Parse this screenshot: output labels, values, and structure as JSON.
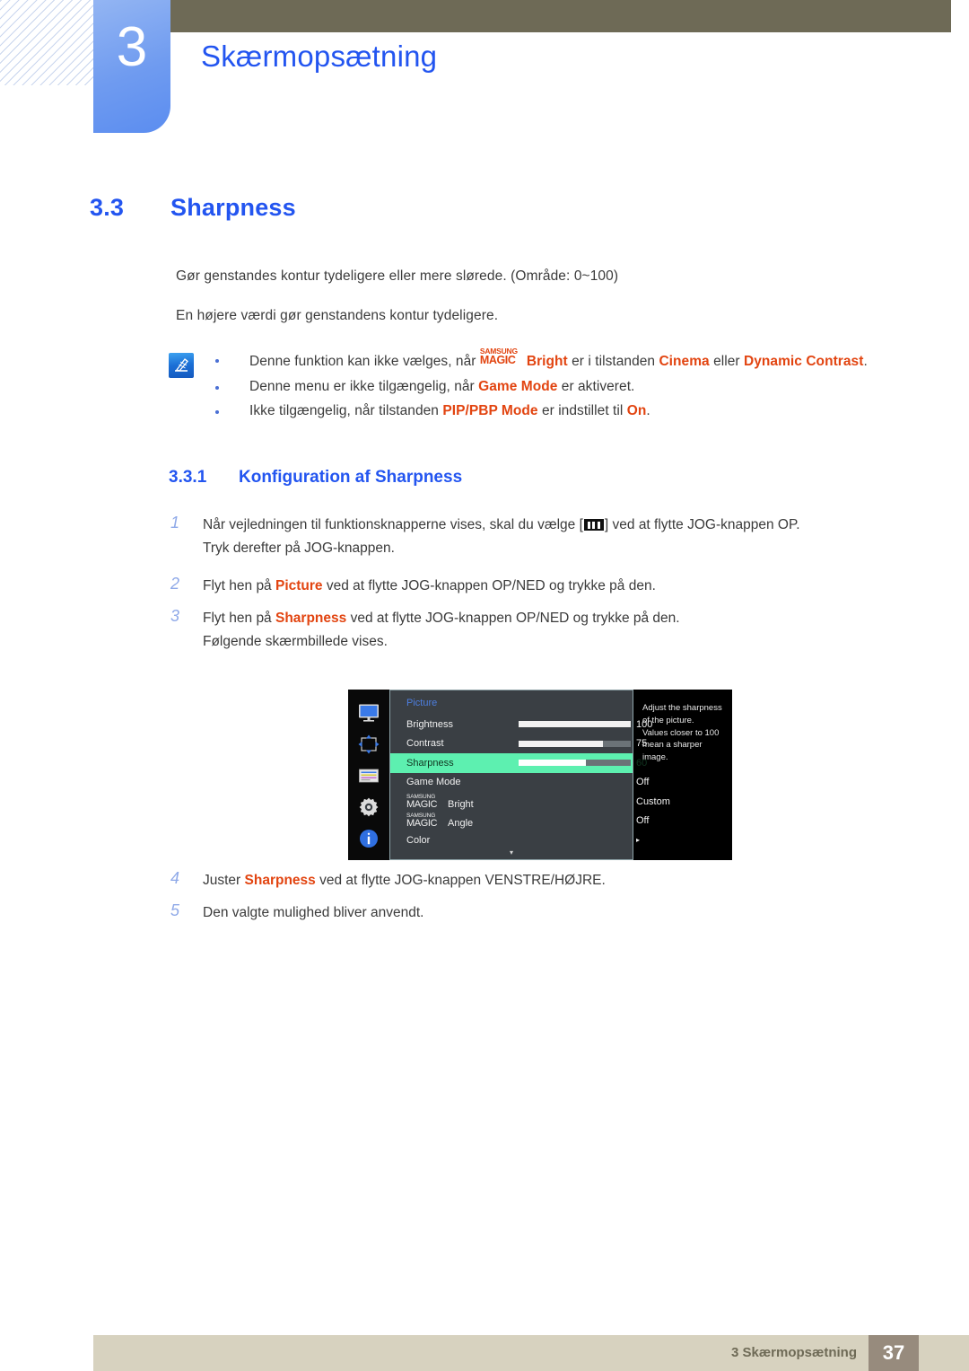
{
  "chapter": {
    "number": "3",
    "title": "Skærmopsætning"
  },
  "section": {
    "number": "3.3",
    "title": "Sharpness"
  },
  "intro": {
    "line1": "Gør genstandes kontur tydeligere eller mere slørede. (Område: 0~100)",
    "line2": "En højere værdi gør genstandens kontur tydeligere."
  },
  "note": {
    "icon": "note-pen-icon",
    "items": [
      {
        "pre": "Denne funktion kan ikke vælges, når ",
        "magic_top": "SAMSUNG",
        "magic_bottom": "MAGIC",
        "magic_suffix": "Bright",
        "mid": " er i tilstanden ",
        "hl1": "Cinema",
        "mid2": " eller ",
        "hl2": "Dynamic Contrast",
        "post": "."
      },
      {
        "pre": "Denne menu er ikke tilgængelig, når ",
        "hl1": "Game Mode",
        "post": " er aktiveret."
      },
      {
        "pre": "Ikke tilgængelig, når tilstanden ",
        "hl1": "PIP/PBP Mode",
        "mid": " er indstillet til ",
        "hl2": "On",
        "post": "."
      }
    ]
  },
  "subsection": {
    "number": "3.3.1",
    "title": "Konfiguration af Sharpness"
  },
  "steps": {
    "s1_num": "1",
    "s1_a": "Når vejledningen til funktionsknapperne vises, skal du vælge [",
    "s1_b": "] ved at flytte JOG-knappen OP.",
    "s1_c": "Tryk derefter på JOG-knappen.",
    "s2_num": "2",
    "s2_a": "Flyt hen på ",
    "s2_hl": "Picture",
    "s2_b": " ved at flytte JOG-knappen OP/NED og trykke på den.",
    "s3_num": "3",
    "s3_a": "Flyt hen på ",
    "s3_hl": "Sharpness",
    "s3_b": " ved at flytte JOG-knappen OP/NED og trykke på den.",
    "s3_c": "Følgende skærmbillede vises.",
    "s4_num": "4",
    "s4_a": "Juster ",
    "s4_hl": "Sharpness",
    "s4_b": " ved at flytte JOG-knappen VENSTRE/HØJRE.",
    "s5_num": "5",
    "s5_a": "Den valgte mulighed bliver anvendt."
  },
  "osd": {
    "title": "Picture",
    "sidebar_icons": [
      "monitor-icon",
      "move-arrows-icon",
      "osd-list-icon",
      "gear-icon",
      "info-icon"
    ],
    "rows": [
      {
        "label": "Brightness",
        "value": "100",
        "bar": 100,
        "type": "slider",
        "selected": false
      },
      {
        "label": "Contrast",
        "value": "75",
        "bar": 75,
        "type": "slider",
        "selected": false
      },
      {
        "label": "Sharpness",
        "value": "60",
        "bar": 60,
        "type": "slider",
        "selected": true
      },
      {
        "label": "Game Mode",
        "value": "Off",
        "type": "value",
        "selected": false
      },
      {
        "label": "Bright",
        "magic_top": "SAMSUNG",
        "magic_bottom": "MAGIC",
        "value": "Custom",
        "type": "magic",
        "selected": false
      },
      {
        "label": "Angle",
        "magic_top": "SAMSUNG",
        "magic_bottom": "MAGIC",
        "value": "Off",
        "type": "magic",
        "selected": false
      },
      {
        "label": "Color",
        "value": "▸",
        "type": "submenu",
        "selected": false
      }
    ],
    "scroll_down": "▾",
    "help_lines": [
      "Adjust the sharpness",
      "of the picture.",
      "Values closer to 100",
      "mean a sharper image."
    ]
  },
  "footer": {
    "text": "3 Skærmopsætning",
    "page": "37"
  },
  "colors": {
    "accent_blue": "#2355f0",
    "highlight_orange": "#e24410",
    "olive": "#6e6a56",
    "osd_selected": "#5df0b0",
    "footer_beige": "#d7d2bf"
  }
}
